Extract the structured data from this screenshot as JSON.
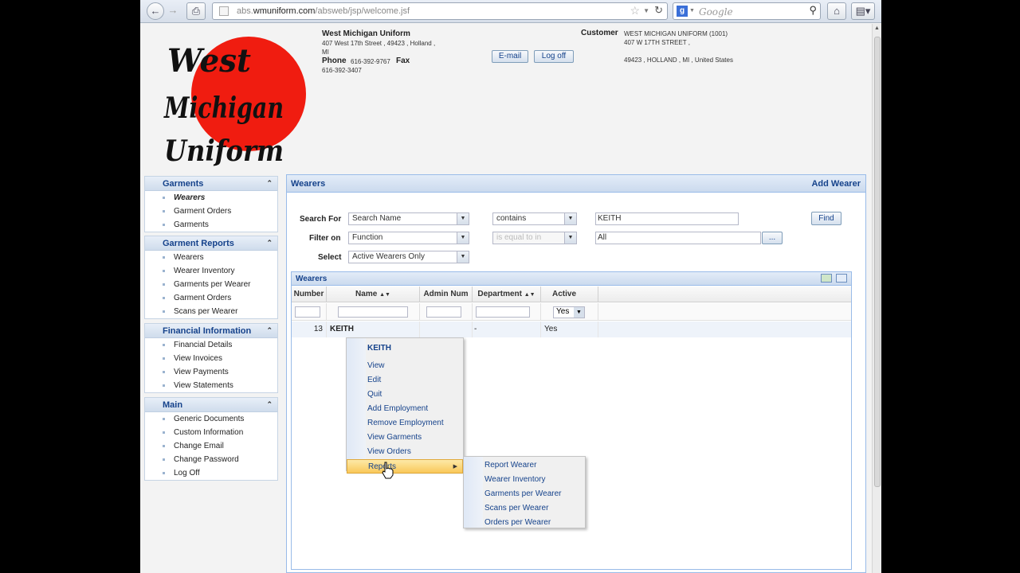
{
  "browser": {
    "url_prefix": "abs.",
    "url_domain": "wmuniform.com",
    "url_path": "/absweb/jsp/welcome.jsf",
    "search_placeholder": "Google"
  },
  "header": {
    "company_name": "West Michigan Uniform",
    "address": "407 West 17th Street , 49423 , Holland ,",
    "address_2": "MI",
    "phone_label": "Phone",
    "phone": "616-392-9767",
    "fax_label": "Fax",
    "fax": "616-392-3407",
    "email_button": "E-mail",
    "logoff_button": "Log off",
    "customer_label": "Customer",
    "customer_name": "WEST MICHIGAN UNIFORM (1001)",
    "customer_street": "407 W 17TH STREET ,",
    "customer_city": "49423 , HOLLAND , MI , United States",
    "logo_line1": "West",
    "logo_line2": "Michigan",
    "logo_line3": "Uniform",
    "logo_color": "#f01c10"
  },
  "sidebar": {
    "sections": [
      {
        "title": "Garments",
        "items": [
          "Wearers",
          "Garment Orders",
          "Garments"
        ]
      },
      {
        "title": "Garment Reports",
        "items": [
          "Wearers",
          "Wearer Inventory",
          "Garments per Wearer",
          "Garment Orders",
          "Scans per Wearer"
        ]
      },
      {
        "title": "Financial Information",
        "items": [
          "Financial Details",
          "View Invoices",
          "View Payments",
          "View Statements"
        ]
      },
      {
        "title": "Main",
        "items": [
          "Generic Documents",
          "Custom Information",
          "Change Email",
          "Change Password",
          "Log Off"
        ]
      }
    ]
  },
  "main": {
    "title": "Wearers",
    "add_link": "Add Wearer",
    "search_for_label": "Search For",
    "search_for_value": "Search Name",
    "operator_value": "contains",
    "search_text": "KEITH",
    "find_button": "Find",
    "filter_on_label": "Filter on",
    "filter_on_value": "Function",
    "filter_operator": "is equal to in",
    "filter_value": "All",
    "ellipsis_button": "...",
    "select_label": "Select",
    "select_value": "Active Wearers Only"
  },
  "grid": {
    "title": "Wearers",
    "columns": [
      "Number",
      "Name",
      "Admin Num",
      "Department",
      "Active"
    ],
    "active_filter": "Yes",
    "row": {
      "number": "13",
      "name": "KEITH",
      "department": "-",
      "active": "Yes"
    }
  },
  "context_menu": {
    "title": "KEITH",
    "items": [
      "View",
      "Edit",
      "Quit",
      "Add Employment",
      "Remove Employment",
      "View Garments",
      "View Orders",
      "Reports"
    ]
  },
  "submenu": {
    "items": [
      "Report Wearer",
      "Wearer Inventory",
      "Garments per Wearer",
      "Scans per Wearer",
      "Orders per Wearer"
    ]
  }
}
